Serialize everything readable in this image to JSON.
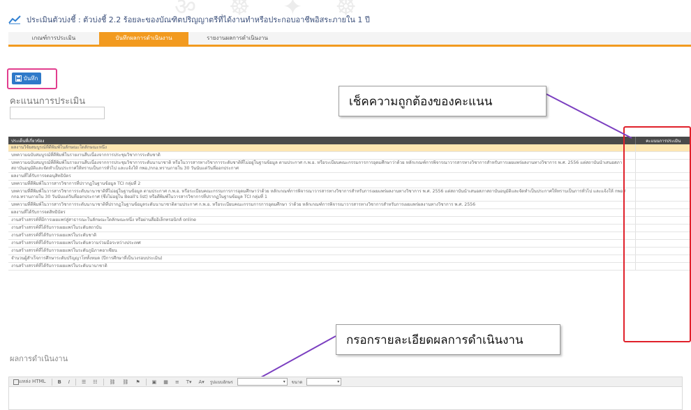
{
  "header": {
    "title": "ประเมินตัวบ่งชี้ : ตัวบ่งชี้ 2.2 ร้อยละของบัณฑิตปริญญาตรีที่ได้งานทำหรือประกอบอาชีพอิสระภายใน 1 ปี"
  },
  "tabs": [
    {
      "label": "เกณฑ์การประเมิน"
    },
    {
      "label": "บันทึกผลการดำเนินงาน"
    },
    {
      "label": "รายงานผลการดำเนินงาน"
    }
  ],
  "toolbar": {
    "save_label": "บันทึก"
  },
  "score": {
    "label": "คะแนนการประเมิน",
    "value": ""
  },
  "callouts": {
    "check_score": "เช็คความถูกต้องของคะแนน",
    "fill_details": "กรอกรายละเอียดผลการดำเนินงาน"
  },
  "table": {
    "headers": [
      "ประเด็นที่เกี่ยวข้อง",
      "คะแนนการประเมิน"
    ],
    "rows": [
      {
        "text": "ผลงานวิจัยสมบูรณ์ที่ตีพิมพ์ในลักษณะใดลักษณะหนึ่ง"
      },
      {
        "text": "บทความฉบับสมบูรณ์ที่ตีพิมพ์ในรายงานสืบเนื่องจากการประชุมวิชาการระดับชาติ"
      },
      {
        "text": "บทความฉบับสมบูรณ์ที่ตีพิมพ์ในรายงานสืบเนื่องจากการประชุมวิชาการระดับนานาชาติ หรือในวารสารทางวิชาการระดับชาติที่ไม่อยู่ในฐานข้อมูล ตามประกาศ ก.พ.อ. หรือระเบียบคณะกรรมการการอุดมศึกษาว่าด้วย หลักเกณฑ์การพิจารณาวารสารทางวิชาการสำหรับการเผยแพร่ผลงานทางวิชาการ พ.ศ. 2556 แต่สถาบันนำเสนอสภาสถาบันอนุมัติและจัดทำเป็นประกาศให้ทราบเป็นการทั่วไป และแจ้งให้ กพอ./กกอ.ทราบภายใน 30 วันนับแต่วันที่ออกประกาศ"
      },
      {
        "text": "ผลงานที่ได้รับการจดอนุสิทธิบัตร"
      },
      {
        "text": "บทความที่ตีพิมพ์ในวารสารวิชาการที่ปรากฏในฐานข้อมูล TCI กลุ่มที่ 2"
      },
      {
        "text": "บทความที่ตีพิมพ์ในวารสารวิชาการระดับนานาชาติที่ไม่อยู่ในฐานข้อมูล ตามประกาศ ก.พ.อ. หรือระเบียบคณะกรรมการการอุดมศึกษาว่าด้วย หลักเกณฑ์การพิจารณาวารสารทางวิชาการสำหรับการเผยแพร่ผลงานทางวิชาการ พ.ศ. 2556 แต่สถาบันนำเสนอสภาสถาบันอนุมัติและจัดทำเป็นประกาศให้ทราบเป็นการทั่วไป และแจ้งให้ กพอ./กกอ.ทราบภายใน 30 วันนับแต่วันที่ออกประกาศ (ซึ่งไม่อยู่ใน Beall's list) หรือตีพิมพ์ในวารสารวิชาการที่ปรากฏในฐานข้อมูล TCI กลุ่มที่ 1"
      },
      {
        "text": "บทความที่ตีพิมพ์ในวารสารวิชาการระดับนานาชาติที่ปรากฏในฐานข้อมูลระดับนานาชาติตามประกาศ ก.พ.อ. หรือระเบียบคณะกรรมการการอุดมศึกษา ว่าด้วย หลักเกณฑ์การพิจารณาวารสารทางวิชาการสำหรับการเผยแพร่ผลงานทางวิชาการ พ.ศ. 2556"
      },
      {
        "text": "ผลงานที่ได้รับการจดสิทธิบัตร"
      },
      {
        "text": "งานสร้างสรรค์ที่มีการเผยแพร่สู่สาธารณะในลักษณะใดลักษณะหนึ่ง หรือผ่านสื่ออิเล็กทรอนิกส์ online"
      },
      {
        "text": "งานสร้างสรรค์ที่ได้รับการเผยแพร่ในระดับสถาบัน"
      },
      {
        "text": "งานสร้างสรรค์ที่ได้รับการเผยแพร่ในระดับชาติ"
      },
      {
        "text": "งานสร้างสรรค์ที่ได้รับการเผยแพร่ในระดับความร่วมมือระหว่างประเทศ"
      },
      {
        "text": "งานสร้างสรรค์ที่ได้รับการเผยแพร่ในระดับภูมิภาคอาเซียน"
      },
      {
        "text": "จำนวนผู้สำเร็จการศึกษาระดับปริญญาโททั้งหมด (ปีการศึกษาที่เป็นวงรอบประเมิน)"
      },
      {
        "text": "งานสร้างสรรค์ที่ได้รับการเผยแพร่ในระดับนานาชาติ"
      }
    ]
  },
  "results": {
    "label": "ผลการดำเนินงาน"
  },
  "editor_toolbar": {
    "source_label": "แหล่ง HTML",
    "format_label": "รูปแบบอักษร",
    "size_label": "ขนาด",
    "bold": "B",
    "italic": "I"
  },
  "colors": {
    "accent": "#f29a1f",
    "save_button": "#2e79c9",
    "highlight_box": "#e23d8e",
    "score_box": "#e0202a",
    "callout_line": "#7b3fc0",
    "row_highlight": "#fde6b2"
  }
}
